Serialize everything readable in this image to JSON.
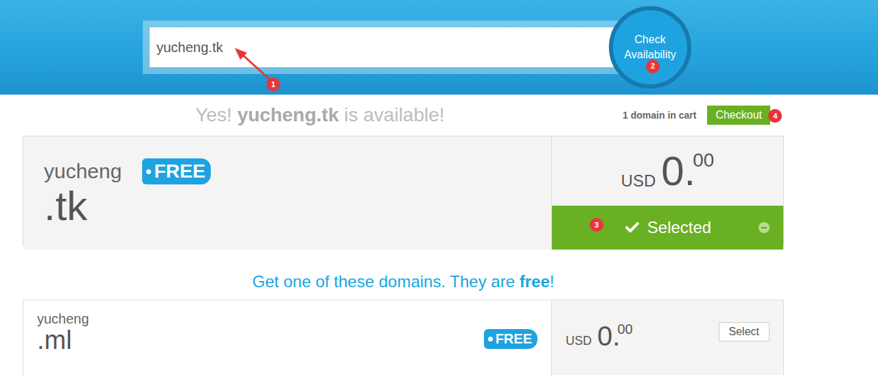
{
  "search": {
    "value": "yucheng.tk",
    "badge": "1"
  },
  "check_button": {
    "label": "Check Availability",
    "badge": "2"
  },
  "result": {
    "prefix": "Yes!",
    "domain": "yucheng.tk",
    "suffix": "is available!"
  },
  "cart": {
    "count_text": "1 domain in cart",
    "checkout": "Checkout",
    "badge": "4"
  },
  "main_domain": {
    "name": "yucheng",
    "tld": ".tk",
    "tag": "FREE",
    "currency": "USD",
    "price_whole": "0.",
    "price_cents": "00",
    "selected": true,
    "button": "Selected",
    "badge": "3"
  },
  "offer_heading": {
    "text": "Get one of these domains. They are",
    "emphasis": "free",
    "end": "!"
  },
  "suggestions": [
    {
      "name": "yucheng",
      "tld": ".ml",
      "tag": "FREE",
      "currency": "USD",
      "price_whole": "0.",
      "price_cents": "00",
      "selected": false,
      "button": "Select"
    }
  ]
}
